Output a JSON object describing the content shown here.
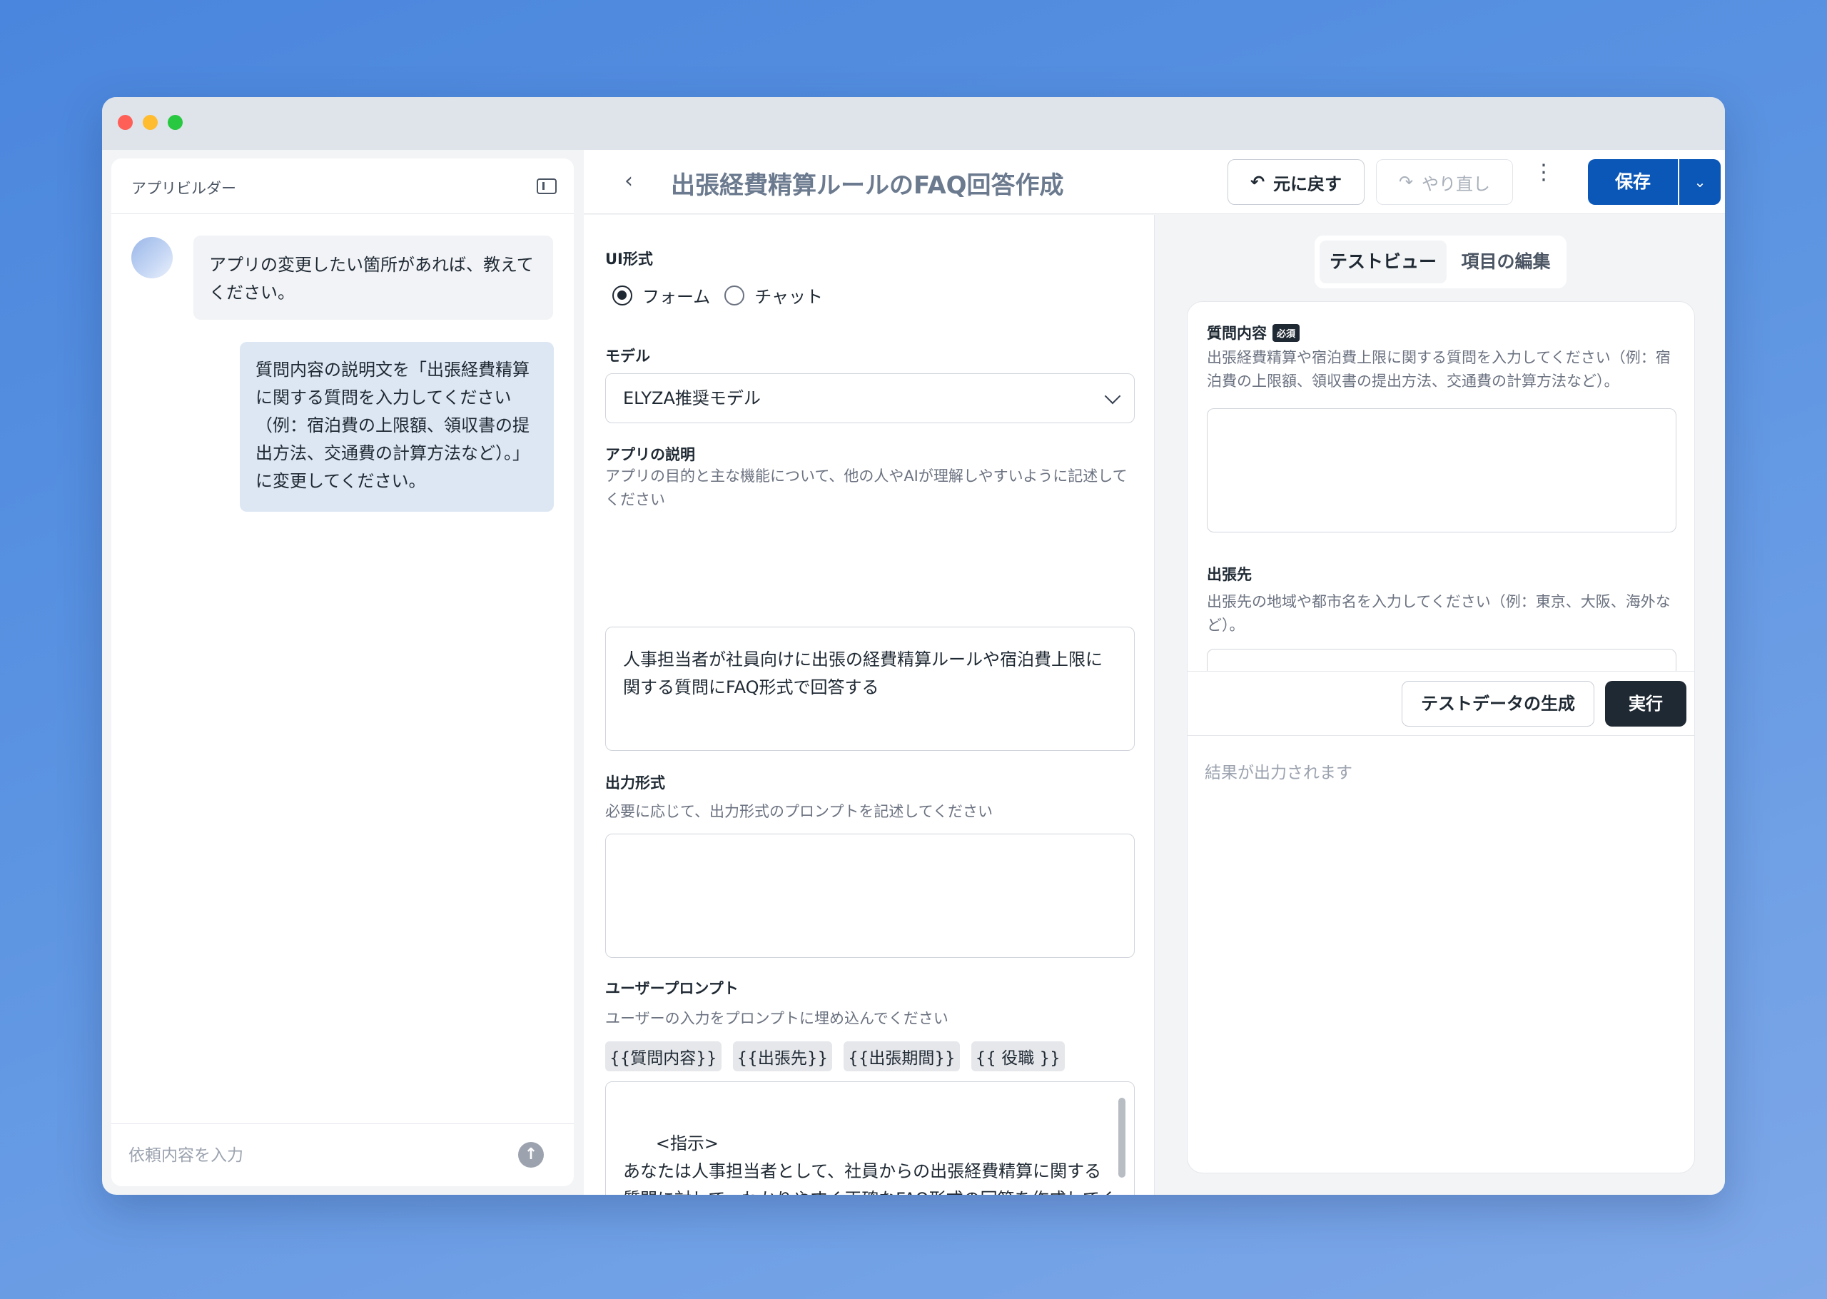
{
  "left_panel": {
    "title": "アプリビルダー",
    "messages": [
      {
        "role": "assistant",
        "text": "アプリの変更したい箇所があれば、教えてください。"
      },
      {
        "role": "user",
        "text": "質問内容の説明文を「出張経費精算に関する質問を入力してください（例：宿泊費の上限額、領収書の提出方法、交通費の計算方法など）。」に変更してください。"
      }
    ],
    "input_placeholder": "依頼内容を入力",
    "send_icon": "↑"
  },
  "header": {
    "back_icon": "‹",
    "title": "出張経費精算ルールのFAQ回答作成",
    "undo_icon": "↶",
    "undo_label": "元に戻す",
    "redo_icon": "↷",
    "redo_label": "やり直し",
    "kebab_icon": "⋮",
    "save_label": "保存",
    "save_dropdown_icon": "⌄"
  },
  "form": {
    "ui_format_label": "UI形式",
    "ui_options": [
      "フォーム",
      "チャット"
    ],
    "ui_selected": "フォーム",
    "model_label": "モデル",
    "model_value": "ELYZA推奨モデル",
    "description_label": "アプリの説明",
    "description_help": "アプリの目的と主な機能について、他の人やAIが理解しやすいように記述してください",
    "description_value": "人事担当者が社員向けに出張の経費精算ルールや宿泊費上限に関する質問にFAQ形式で回答する",
    "output_label": "出力形式",
    "output_help": "必要に応じて、出力形式のプロンプトを記述してください",
    "output_value": "",
    "user_prompt_label": "ユーザープロンプト",
    "user_prompt_help": "ユーザーの入力をプロンプトに埋め込んでください",
    "variables": [
      "{{質問内容}}",
      "{{出張先}}",
      "{{出張期間}}",
      "{{ 役職 }}"
    ],
    "user_prompt_value": "<指示>\nあなたは人事担当者として、社員からの出張経費精算に関する質問に対して、わかりやすく正確なFAQ形式の回答を作成してください。\n</指示>\n\n<手順>"
  },
  "test": {
    "tabs": [
      "テストビュー",
      "項目の編集"
    ],
    "active_tab": "テストビュー",
    "fields": [
      {
        "label": "質問内容",
        "required_badge": "必須",
        "help": "出張経費精算や宿泊費上限に関する質問を入力してください（例：宿泊費の上限額、領収書の提出方法、交通費の計算方法など）。"
      },
      {
        "label": "出張先",
        "required_badge": "",
        "help": "出張先の地域や都市名を入力してください（例：東京、大阪、海外など）。"
      }
    ],
    "generate_label": "テストデータの生成",
    "run_label": "実行",
    "result_placeholder": "結果が出力されます"
  }
}
